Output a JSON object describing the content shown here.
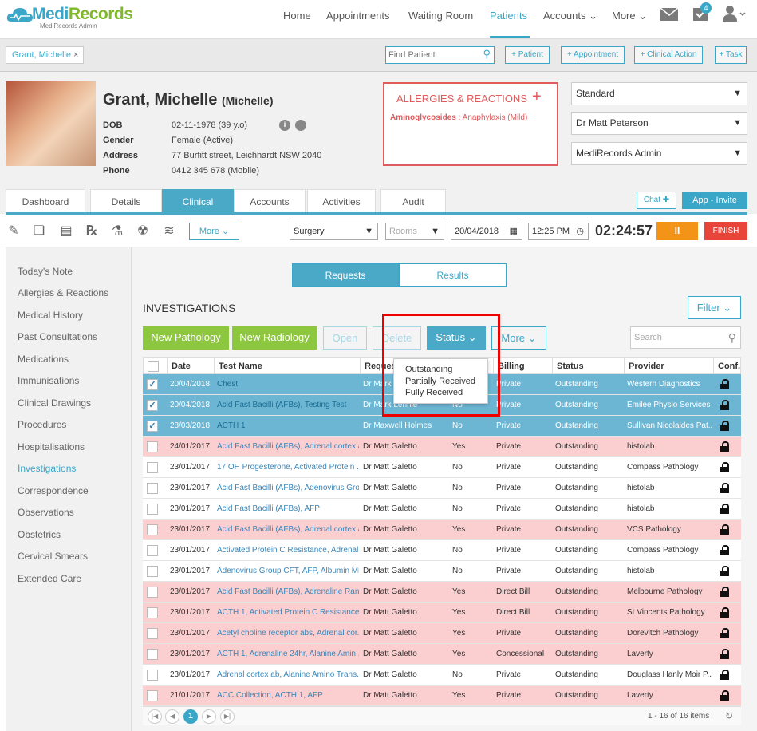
{
  "brand": {
    "name_a": "Medi",
    "name_b": "Records",
    "sub": "MediRecords Admin"
  },
  "nav": {
    "items": [
      "Home",
      "Appointments",
      "Waiting Room",
      "Patients",
      "Accounts",
      "More"
    ],
    "badge": "4"
  },
  "subbar": {
    "patient_tab": "Grant, Michelle",
    "find_placeholder": "Find Patient",
    "buttons": [
      "+ Patient",
      "+ Appointment",
      "+ Clinical Action",
      "+ Task"
    ]
  },
  "patient": {
    "name": "Grant, Michelle",
    "preferred": "(Michelle)",
    "labels": [
      "DOB",
      "Gender",
      "Address",
      "Phone"
    ],
    "values": [
      "02-11-1978 (39 y.o)",
      "Female (Active)",
      "77 Burfitt street, Leichhardt NSW 2040",
      "0412 345 678 (Mobile)"
    ]
  },
  "allergies": {
    "title": "ALLERGIES & REACTIONS",
    "plus": "+",
    "item_name": "Aminoglycosides",
    "item_reaction": " : Anaphylaxis (Mild)"
  },
  "selects": [
    "Standard",
    "Dr Matt Peterson",
    "MediRecords Admin"
  ],
  "tabs": [
    "Dashboard",
    "Details",
    "Clinical",
    "Accounts",
    "Activities",
    "Audit"
  ],
  "chat": "Chat",
  "app_invite": "App - Invite",
  "toolbar": {
    "more": "More",
    "location": "Surgery",
    "rooms": "Rooms",
    "date": "20/04/2018",
    "time": "12:25 PM",
    "timer": "02:24:57",
    "pause": "II",
    "finish": "FINISH"
  },
  "sidebar": [
    "Today's Note",
    "Allergies & Reactions",
    "Medical History",
    "Past Consultations",
    "Medications",
    "Immunisations",
    "Clinical Drawings",
    "Procedures",
    "Hospitalisations",
    "Investigations",
    "Correspondence",
    "Observations",
    "Obstetrics",
    "Cervical Smears",
    "Extended Care"
  ],
  "segment": [
    "Requests",
    "Results"
  ],
  "section_title": "INVESTIGATIONS",
  "filter": "Filter",
  "buttons": {
    "new_path": "New Pathology",
    "new_rad": "New Radiology",
    "open": "Open",
    "delete": "Delete",
    "status": "Status",
    "more": "More",
    "search": "Search"
  },
  "status_menu": [
    "Outstanding",
    "Partially Received",
    "Fully Received"
  ],
  "table": {
    "headers": [
      "Date",
      "Test Name",
      "Reques",
      "",
      "Billing",
      "Status",
      "Provider",
      "Conf."
    ],
    "rows": [
      [
        "20/04/2018",
        "Chest",
        "Dr Mark",
        "",
        "Private",
        "Outstanding",
        "Western Diagnostics"
      ],
      [
        "20/04/2018",
        "Acid Fast Bacilli (AFBs), Testing Test",
        "Dr Mark Lennie",
        "No",
        "Private",
        "Outstanding",
        "Emilee Physio Services"
      ],
      [
        "28/03/2018",
        "ACTH 1",
        "Dr Maxwell Holmes",
        "No",
        "Private",
        "Outstanding",
        "Sullivan Nicolaides Pat..."
      ],
      [
        "24/01/2017",
        "Acid Fast Bacilli (AFBs), Adrenal cortex a...",
        "Dr Matt Galetto",
        "Yes",
        "Private",
        "Outstanding",
        "histolab"
      ],
      [
        "23/01/2017",
        "17 OH Progesterone, Activated Protein ...",
        "Dr Matt Galetto",
        "No",
        "Private",
        "Outstanding",
        "Compass Pathology"
      ],
      [
        "23/01/2017",
        "Acid Fast Bacilli (AFBs), Adenovirus Grou...",
        "Dr Matt Galetto",
        "No",
        "Private",
        "Outstanding",
        "histolab"
      ],
      [
        "23/01/2017",
        "Acid Fast Bacilli (AFBs), AFP",
        "Dr Matt Galetto",
        "No",
        "Private",
        "Outstanding",
        "histolab"
      ],
      [
        "23/01/2017",
        "Acid Fast Bacilli (AFBs), Adrenal cortex a...",
        "Dr Matt Galetto",
        "Yes",
        "Private",
        "Outstanding",
        "VCS Pathology"
      ],
      [
        "23/01/2017",
        "Activated Protein C Resistance, Adrenali...",
        "Dr Matt Galetto",
        "No",
        "Private",
        "Outstanding",
        "Compass Pathology"
      ],
      [
        "23/01/2017",
        "Adenovirus Group CFT, AFP, Albumin Mi...",
        "Dr Matt Galetto",
        "No",
        "Private",
        "Outstanding",
        "histolab"
      ],
      [
        "23/01/2017",
        "Acid Fast Bacilli (AFBs), Adrenaline Rand...",
        "Dr Matt Galetto",
        "Yes",
        "Direct Bill",
        "Outstanding",
        "Melbourne Pathology"
      ],
      [
        "23/01/2017",
        "ACTH 1, Activated Protein C Resistance, ...",
        "Dr Matt Galetto",
        "Yes",
        "Direct Bill",
        "Outstanding",
        "St Vincents Pathology"
      ],
      [
        "23/01/2017",
        "Acetyl choline receptor abs, Adrenal cor...",
        "Dr Matt Galetto",
        "Yes",
        "Private",
        "Outstanding",
        "Dorevitch Pathology"
      ],
      [
        "23/01/2017",
        "ACTH 1, Adrenaline 24hr, Alanine Amin...",
        "Dr Matt Galetto",
        "Yes",
        "Concessional",
        "Outstanding",
        "Laverty"
      ],
      [
        "23/01/2017",
        "Adrenal cortex ab, Alanine Amino Trans...",
        "Dr Matt Galetto",
        "No",
        "Private",
        "Outstanding",
        "Douglass Hanly Moir P..."
      ],
      [
        "21/01/2017",
        "ACC Collection, ACTH 1, AFP",
        "Dr Matt Galetto",
        "Yes",
        "Private",
        "Outstanding",
        "Laverty"
      ]
    ],
    "row_styles": [
      "sel",
      "sel",
      "sel",
      "red",
      "white",
      "white",
      "white",
      "red",
      "white",
      "white",
      "red",
      "red",
      "red",
      "red",
      "white",
      "red"
    ],
    "row_checked": [
      true,
      true,
      true,
      false,
      false,
      false,
      false,
      false,
      false,
      false,
      true,
      true,
      true,
      true,
      false,
      false
    ]
  },
  "pager": {
    "page": "1",
    "summary": "1 - 16 of 16 items"
  }
}
